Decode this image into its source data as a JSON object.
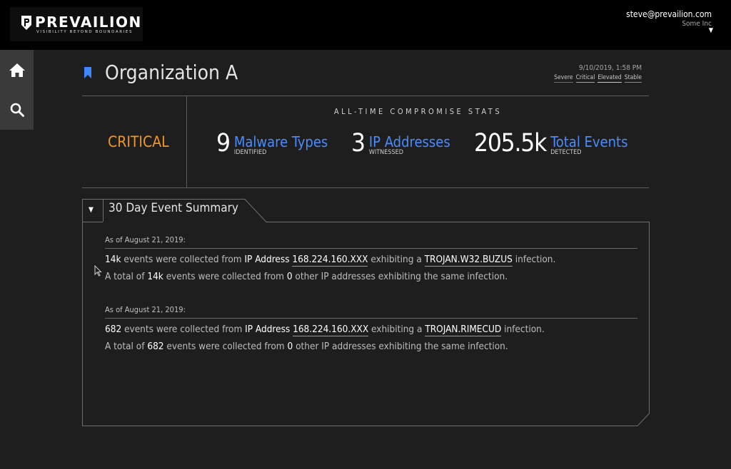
{
  "brand": {
    "name": "PREVAILION",
    "tagline": "VISIBILITY BEYOND BOUNDARIES"
  },
  "user": {
    "email": "steve@prevailion.com",
    "org": "Some Inc",
    "menu_icon": "caret-down-icon"
  },
  "nav": [
    {
      "name": "home",
      "icon": "home-icon"
    },
    {
      "name": "search",
      "icon": "search-icon"
    }
  ],
  "page": {
    "title": "Organization A",
    "timestamp": "9/10/2019, 1:58 PM",
    "legend": [
      {
        "label": "Severe",
        "color": "#e03c3c"
      },
      {
        "label": "Critical",
        "color": "#f0962a"
      },
      {
        "label": "Elevated",
        "color": "#e8d23a"
      },
      {
        "label": "Stable",
        "color": "#4cb84c"
      }
    ]
  },
  "stats": {
    "status": "CRITICAL",
    "status_color": "#f0962a",
    "heading": "ALL-TIME COMPROMISE STATS",
    "items": [
      {
        "value": "9",
        "label": "Malware Types",
        "sub": "IDENTIFIED"
      },
      {
        "value": "3",
        "label": "IP Addresses",
        "sub": "WITNESSED"
      },
      {
        "value": "205.5k",
        "label": "Total Events",
        "sub": "DETECTED"
      }
    ]
  },
  "summary": {
    "tab_title": "30 Day Event Summary",
    "entries": [
      {
        "date": "As of August 21, 2019:",
        "count": "14k",
        "t1": "events were collected from",
        "t2": "IP Address",
        "ip": "168.224.160.XXX",
        "t3": "exhibiting a",
        "malware": "TROJAN.W32.BUZUS",
        "t4": "infection.",
        "t5": "A total of",
        "total": "14k",
        "t6": "events were collected from",
        "others": "0",
        "t7": "other IP addresses exhibiting the same infection."
      },
      {
        "date": "As of August 21, 2019:",
        "count": "682",
        "t1": "events were collected from",
        "t2": "IP Address",
        "ip": "168.224.160.XXX",
        "t3": "exhibiting a",
        "malware": "TROJAN.RIMECUD",
        "t4": "infection.",
        "t5": "A total of",
        "total": "682",
        "t6": "events were collected from",
        "others": "0",
        "t7": "other IP addresses exhibiting the same infection."
      }
    ]
  }
}
